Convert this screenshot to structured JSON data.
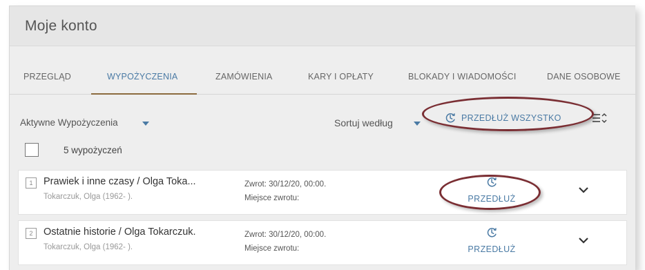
{
  "page": {
    "title": "Moje konto"
  },
  "tabs": [
    {
      "label": "PRZEGLĄD"
    },
    {
      "label": "WYPOŻYCZENIA"
    },
    {
      "label": "ZAMÓWIENIA"
    },
    {
      "label": "KARY I OPŁATY"
    },
    {
      "label": "BLOKADY I WIADOMOŚCI"
    },
    {
      "label": "DANE OSOBOWE"
    }
  ],
  "active_tab": "WYPOŻYCZENIA",
  "toolbar": {
    "filter_label": "Aktywne Wypożyczenia",
    "sort_label": "Sortuj według",
    "extend_all_label": "PRZEDŁUŻ WSZYSTKO"
  },
  "count_text": "5 wypożyczeń",
  "loans": [
    {
      "number": "1",
      "title": "Prawiek i inne czasy / Olga Toka...",
      "author": "Tokarczuk, Olga (1962- ).",
      "due": "Zwrot: 30/12/20, 00:00.",
      "place": "Miejsce zwrotu:",
      "renew_label": "PRZEDŁUŻ"
    },
    {
      "number": "2",
      "title": "Ostatnie historie / Olga Tokarczuk.",
      "author": "Tokarczuk, Olga (1962- ).",
      "due": "Zwrot: 30/12/20, 00:00.",
      "place": "Miejsce zwrotu:",
      "renew_label": "PRZEDŁUŻ"
    }
  ],
  "colors": {
    "accent": "#4a7aa4",
    "tab_underline": "#8b6a3e",
    "highlight_ellipse": "#7a2e33"
  },
  "icons": [
    "renew-clock-icon",
    "chevron-down-icon",
    "caret-down-icon",
    "sort-list-icon"
  ]
}
